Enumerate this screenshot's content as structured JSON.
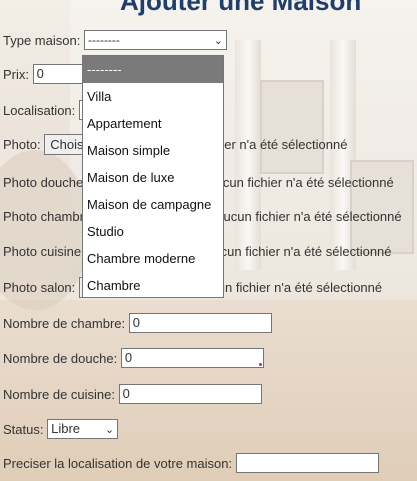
{
  "page": {
    "title": "Ajouter une Maison"
  },
  "form": {
    "type_maison": {
      "label": "Type maison:",
      "value": "--------"
    },
    "prix": {
      "label": "Prix:",
      "value": "0"
    },
    "localisation": {
      "label": "Localisation:"
    },
    "photo": {
      "label": "Photo:",
      "button": "Choisir un fichier",
      "status": "Aucun fichier n'a été sélectionné"
    },
    "photo_douche": {
      "label": "Photo douche:",
      "status": "Aucun fichier n'a été sélectionné"
    },
    "photo_chambre": {
      "label": "Photo chambre:",
      "status": "Aucun fichier n'a été sélectionné"
    },
    "photo_cuisine": {
      "label": "Photo cuisine:",
      "status": "Aucun fichier n'a été sélectionné"
    },
    "photo_salon": {
      "label": "Photo salon:",
      "status": "Aucun fichier n'a été sélectionné"
    },
    "nombre_chambre": {
      "label": "Nombre de chambre:",
      "value": "0"
    },
    "nombre_douche": {
      "label": "Nombre de douche:",
      "value": "0"
    },
    "nombre_cuisine": {
      "label": "Nombre de cuisine:",
      "value": "0"
    },
    "status": {
      "label": "Status:",
      "value": "Libre"
    },
    "preciser": {
      "label": "Preciser la localisation de votre maison:",
      "value": ""
    }
  },
  "dropdown": {
    "options": [
      "--------",
      "Villa",
      "Appartement",
      "Maison simple",
      "Maison de luxe",
      "Maison de campagne",
      "Studio",
      "Chambre moderne",
      "Chambre"
    ],
    "highlighted_index": 0
  },
  "colors": {
    "title": "#1e3f6d",
    "highlight": "#7a7a7a"
  }
}
